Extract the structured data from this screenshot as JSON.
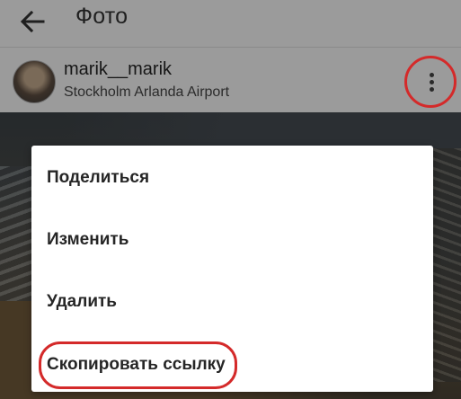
{
  "header": {
    "title": "Фото",
    "back_icon": "arrow-left-icon"
  },
  "post": {
    "username": "marik__marik",
    "location": "Stockholm Arlanda Airport",
    "more_icon": "more-vertical-icon"
  },
  "menu": {
    "items": [
      {
        "label": "Поделиться"
      },
      {
        "label": "Изменить"
      },
      {
        "label": "Удалить"
      },
      {
        "label": "Скопировать ссылку"
      }
    ]
  },
  "annotations": {
    "color": "#d42a2a"
  }
}
